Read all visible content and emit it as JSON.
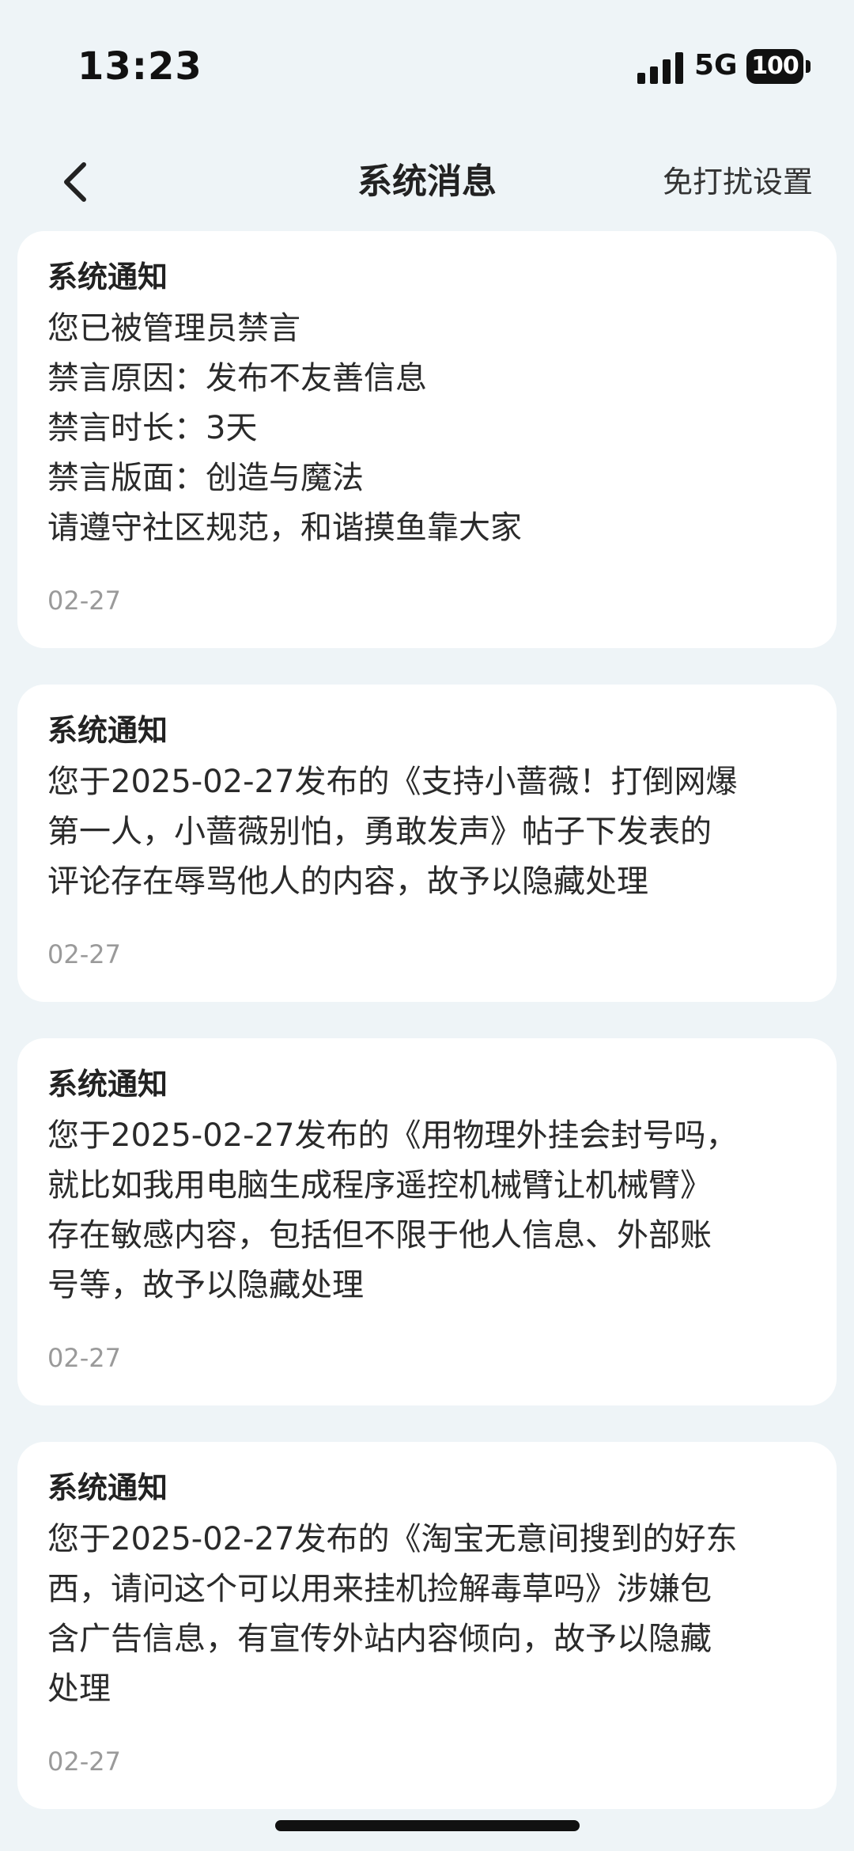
{
  "status_bar": {
    "time": "13:23",
    "network": "5G",
    "battery": "100"
  },
  "nav": {
    "title": "系统消息",
    "right_action": "免打扰设置",
    "back_icon": "chevron-left-icon"
  },
  "messages": [
    {
      "title": "系统通知",
      "lines": [
        "您已被管理员禁言",
        "禁言原因：发布不友善信息",
        "禁言时长：3天",
        "禁言版面：创造与魔法",
        "请遵守社区规范，和谐摸鱼靠大家"
      ],
      "date": "02-27"
    },
    {
      "title": "系统通知",
      "lines": [
        "您于2025-02-27发布的《支持小蔷薇！打倒网爆",
        "第一人，小蔷薇别怕，勇敢发声》帖子下发表的",
        "评论存在辱骂他人的内容，故予以隐藏处理"
      ],
      "date": "02-27"
    },
    {
      "title": "系统通知",
      "lines": [
        "您于2025-02-27发布的《用物理外挂会封号吗，",
        "就比如我用电脑生成程序遥控机械臂让机械臂》",
        "存在敏感内容，包括但不限于他人信息、外部账",
        "号等，故予以隐藏处理"
      ],
      "date": "02-27"
    },
    {
      "title": "系统通知",
      "lines": [
        "您于2025-02-27发布的《淘宝无意间搜到的好东",
        "西，请问这个可以用来挂机捡解毒草吗》涉嫌包",
        "含广告信息，有宣传外站内容倾向，故予以隐藏",
        "处理"
      ],
      "date": "02-27"
    }
  ]
}
